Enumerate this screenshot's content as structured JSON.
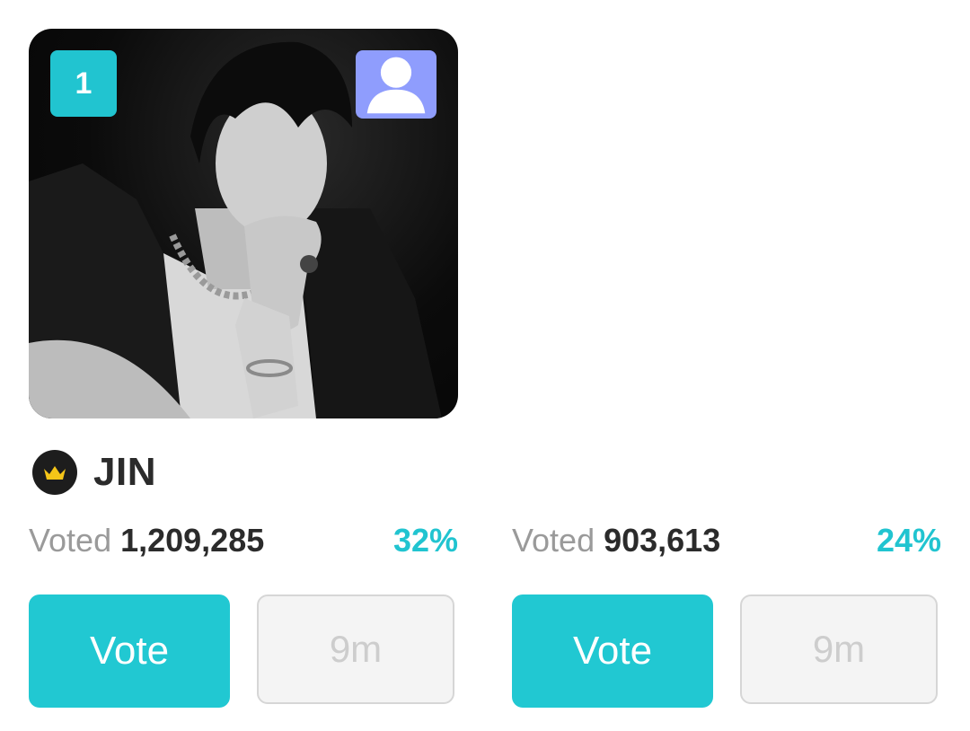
{
  "colors": {
    "accent": "#21c8d2",
    "rank_badge": "#21c4d0",
    "profile_button": "#8f9dfd",
    "crown_bg": "#1d1d1d",
    "crown": "#f5c518",
    "timer_text": "#cdcdcd"
  },
  "cards": [
    {
      "rank": "1",
      "name": "JIN",
      "voted_label": "Voted",
      "voted_count": "1,209,285",
      "percent": "32%",
      "vote_label": "Vote",
      "timer_label": "9m",
      "icons": [
        "user-icon",
        "crown-icon"
      ]
    },
    {
      "voted_label": "Voted",
      "voted_count": "903,613",
      "percent": "24%",
      "vote_label": "Vote",
      "timer_label": "9m"
    }
  ]
}
